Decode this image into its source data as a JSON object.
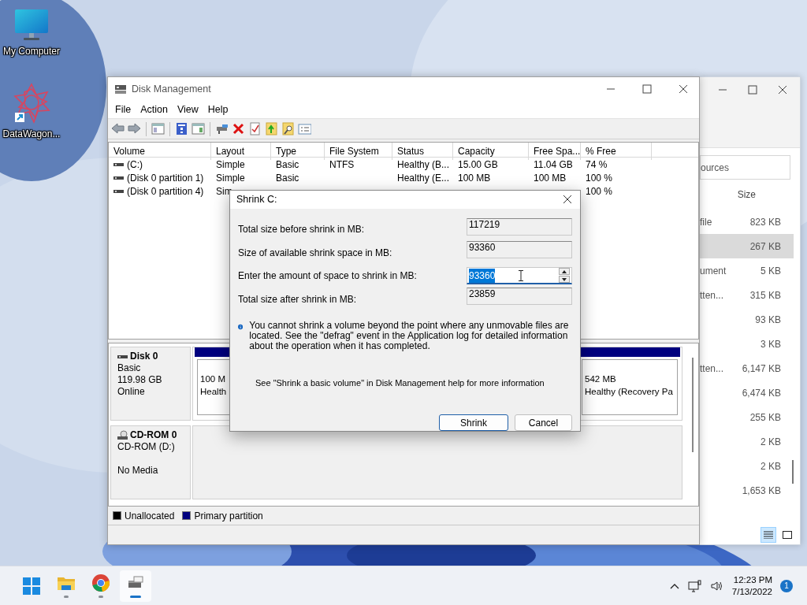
{
  "desktop_icons": [
    {
      "label": "My Computer",
      "kind": "monitor"
    },
    {
      "label": "DataWagon...",
      "kind": "star"
    }
  ],
  "explorer_window": {
    "search_text": "ources",
    "size_header": "Size",
    "rows": [
      {
        "name": "file",
        "size": "823 KB",
        "selected": false
      },
      {
        "size": "267 KB",
        "selected": true
      },
      {
        "name": "ument",
        "size": "5 KB",
        "selected": false
      },
      {
        "name": "tten...",
        "size": "315 KB",
        "selected": false
      },
      {
        "size": "93 KB",
        "selected": false
      },
      {
        "size": "3 KB",
        "selected": false
      },
      {
        "name": "tten...",
        "size": "6,147 KB",
        "selected": false
      },
      {
        "size": "6,474 KB",
        "selected": false
      },
      {
        "size": "255 KB",
        "selected": false
      },
      {
        "size": "2 KB",
        "selected": false
      },
      {
        "size": "2 KB",
        "selected": false
      },
      {
        "size": "1,653 KB",
        "selected": false
      }
    ],
    "views": [
      {
        "kind": "details",
        "selected": true
      },
      {
        "kind": "tiles",
        "selected": false
      }
    ]
  },
  "disk_management": {
    "title": "Disk Management",
    "menu": [
      "File",
      "Action",
      "View",
      "Help"
    ],
    "columns": [
      "Volume",
      "Layout",
      "Type",
      "File System",
      "Status",
      "Capacity",
      "Free Spa...",
      "% Free"
    ],
    "volumes": [
      {
        "volume": "(C:)",
        "layout": "Simple",
        "type": "Basic",
        "file_system": "NTFS",
        "status": "Healthy (B...",
        "capacity": "15.00 GB",
        "free_space": "11.04 GB",
        "percent_free": "74 %"
      },
      {
        "volume": "(Disk 0 partition 1)",
        "layout": "Simple",
        "type": "Basic",
        "status": "Healthy (E...",
        "capacity": "100 MB",
        "free_space": "100 MB",
        "percent_free": "100 %"
      },
      {
        "volume": "(Disk 0 partition 4)",
        "layout": "Sim",
        "percent_free": "100 %"
      }
    ],
    "disks": [
      {
        "kind": "disk",
        "name": "Disk 0",
        "type": "Basic",
        "size": "119.98 GB",
        "status": "Online",
        "partitions": [
          {
            "size": "100 M",
            "status": "Health",
            "color": "#00007f"
          },
          {
            "size": "542 MB",
            "status": "Healthy (Recovery Pa",
            "color": "#00007f"
          }
        ]
      },
      {
        "kind": "cdrom",
        "name": "CD-ROM 0",
        "type": "CD-ROM (D:)",
        "status": "No Media"
      }
    ],
    "legend": [
      {
        "label": "Unallocated",
        "color": "#000000"
      },
      {
        "label": "Primary partition",
        "color": "#00007f"
      }
    ]
  },
  "dialog": {
    "title": "Shrink C:",
    "fields": [
      {
        "label": "Total size before shrink in MB:",
        "value": "117219",
        "kind": "readonly"
      },
      {
        "label": "Size of available shrink space in MB:",
        "value": "93360",
        "kind": "readonly"
      },
      {
        "label": "Enter the amount of space to shrink in MB:",
        "value": "93360",
        "kind": "spin",
        "text_selected": true
      },
      {
        "label": "Total size after shrink in MB:",
        "value": "23859",
        "kind": "readonly"
      }
    ],
    "info": "You cannot shrink a volume beyond the point where any unmovable files are located. See the \"defrag\" event in the Application log for detailed information about the operation when it has completed.",
    "help": "See \"Shrink a basic volume\" in Disk Management help for more information",
    "buttons": [
      {
        "label": "Shrink",
        "default": true
      },
      {
        "label": "Cancel",
        "default": false
      }
    ]
  },
  "taskbar": {
    "apps": [
      {
        "kind": "start",
        "running": false,
        "selected": false
      },
      {
        "kind": "explorer",
        "running": true,
        "selected": false
      },
      {
        "kind": "browser",
        "running": true,
        "selected": false
      },
      {
        "kind": "disk",
        "running": true,
        "selected": true
      }
    ],
    "time": "12:23 PM",
    "date": "7/13/2022",
    "notifications": "1"
  }
}
